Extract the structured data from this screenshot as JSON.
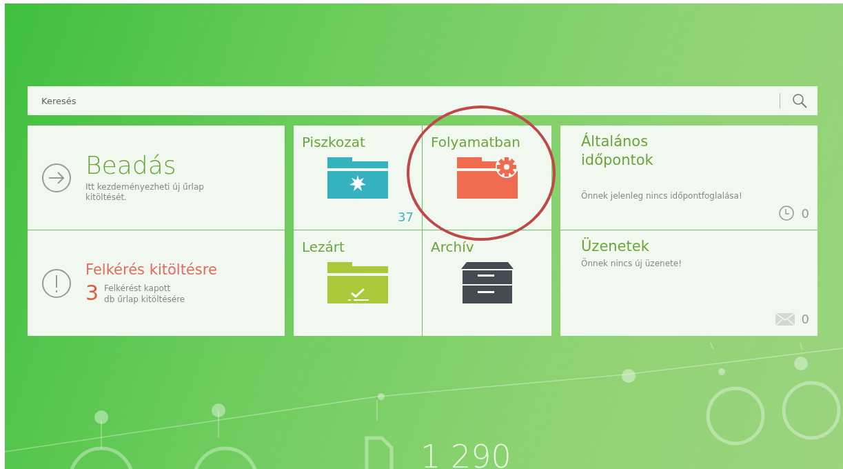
{
  "search": {
    "placeholder": "Keresés"
  },
  "submit": {
    "title": "Beadás",
    "text": "Itt kezdeményezheti új űrlap kitöltését."
  },
  "request": {
    "title": "Felkérés kitöltésre",
    "count": "3",
    "lines": [
      "Felkérést kapott",
      "db űrlap kitöltésére"
    ]
  },
  "folders": [
    {
      "kind": "draft",
      "label": "Piszkozat",
      "count": "37"
    },
    {
      "kind": "in_progress",
      "label": "Folyamatban"
    },
    {
      "kind": "closed",
      "label": "Lezárt"
    },
    {
      "kind": "archive",
      "label": "Archív"
    }
  ],
  "appointments": {
    "title_lines": [
      "Általános",
      "időpontok"
    ],
    "text": "Önnek jelenleg nincs időpontfoglalása!",
    "count": "0"
  },
  "messages": {
    "title": "Üzenetek",
    "text": "Önnek nincs új üzenete!",
    "count": "0"
  },
  "background": {
    "caption": "1 290"
  }
}
